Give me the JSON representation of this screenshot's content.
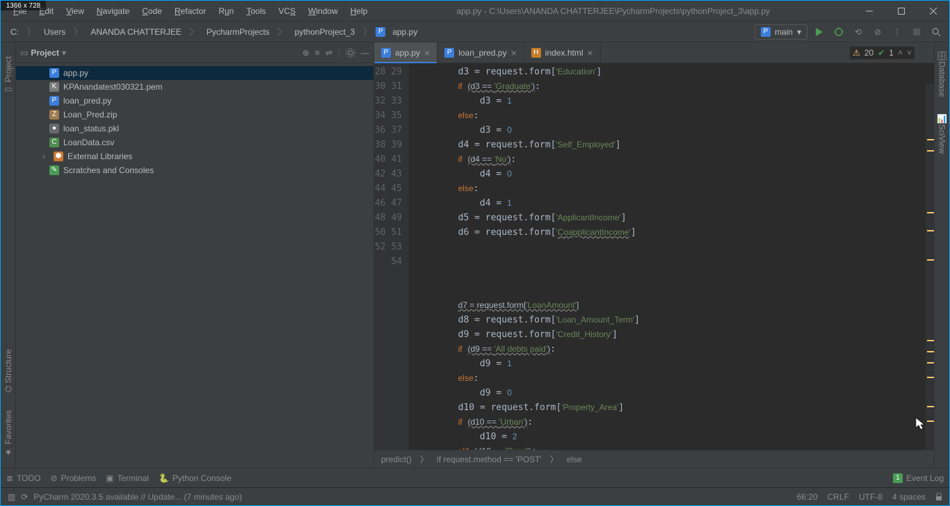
{
  "window": {
    "dim_badge": "1366 x 728",
    "title_path": "app.py - C:\\Users\\ANANDA CHATTERJEE\\PycharmProjects\\pythonProject_3\\app.py"
  },
  "menu": {
    "file": "File",
    "edit": "Edit",
    "view": "View",
    "navigate": "Navigate",
    "code": "Code",
    "refactor": "Refactor",
    "run": "Run",
    "tools": "Tools",
    "vcs": "VCS",
    "window": "Window",
    "help": "Help"
  },
  "breadcrumb": {
    "root": "C:",
    "users": "Users",
    "user": "ANANDA CHATTERJEE",
    "proj_dir": "PycharmProjects",
    "proj": "pythonProject_3",
    "file": "app.py"
  },
  "run_config": "main",
  "left_tools": {
    "project": "Project",
    "structure": "Structure",
    "favorites": "Favorites"
  },
  "right_tools": {
    "database": "Database",
    "sciview": "SciView"
  },
  "project_panel": {
    "title": "Project",
    "items": [
      {
        "name": "app.py",
        "icon": "fi-py",
        "selected": true
      },
      {
        "name": "KPAnandatest030321.pem",
        "icon": "fi-pem"
      },
      {
        "name": "loan_pred.py",
        "icon": "fi-py"
      },
      {
        "name": "Loan_Pred.zip",
        "icon": "fi-zip"
      },
      {
        "name": "loan_status.pkl",
        "icon": "fi-pkl"
      },
      {
        "name": "LoanData.csv",
        "icon": "fi-csv"
      }
    ],
    "external": "External Libraries",
    "scratches": "Scratches and Consoles"
  },
  "tabs": [
    {
      "name": "app.py",
      "icon": "fi-py",
      "active": true
    },
    {
      "name": "loan_pred.py",
      "icon": "fi-py"
    },
    {
      "name": "index.html",
      "icon": "fi-html"
    }
  ],
  "inspection": {
    "warn_count": "20",
    "ok_count": "1"
  },
  "line_start": 28,
  "line_end": 54,
  "editor_crumbs": {
    "a": "predict()",
    "b": "if request.method == 'POST'",
    "c": "else"
  },
  "bottom_tools": {
    "todo": "TODO",
    "problems": "Problems",
    "terminal": "Terminal",
    "pyconsole": "Python Console"
  },
  "eventlog": {
    "badge": "1",
    "label": "Event Log"
  },
  "status": {
    "update_msg": "PyCharm 2020.3.5 available // Update... (7 minutes ago)",
    "pos": "66:20",
    "eol": "CRLF",
    "enc": "UTF-8",
    "indent": "4 spaces"
  }
}
